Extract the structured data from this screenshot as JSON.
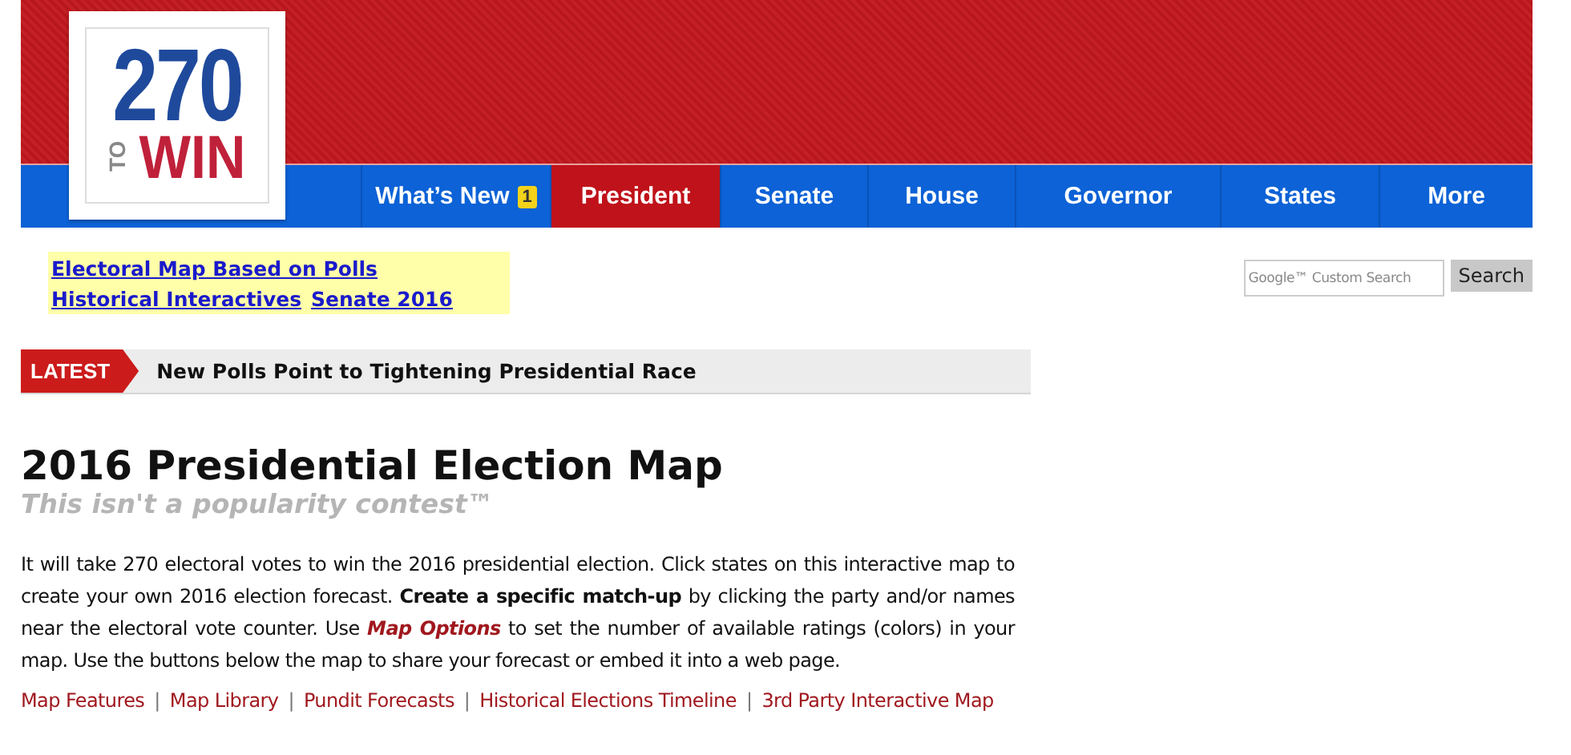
{
  "logo": {
    "number": "270",
    "small": "TO",
    "word": "WIN"
  },
  "nav": [
    {
      "label": "What’s New",
      "badge": "1",
      "selected": false
    },
    {
      "label": "President",
      "selected": true
    },
    {
      "label": "Senate",
      "selected": false
    },
    {
      "label": "House",
      "selected": false
    },
    {
      "label": "Governor",
      "selected": false
    },
    {
      "label": "States",
      "selected": false
    },
    {
      "label": "More",
      "selected": false
    }
  ],
  "quick_links": [
    [
      "Electoral Map Based on Polls"
    ],
    [
      "Historical Interactives",
      "Senate 2016"
    ]
  ],
  "search": {
    "placeholder": "Google™ Custom Search",
    "button": "Search"
  },
  "latest": {
    "label": "LATEST",
    "headline": "New Polls Point to Tightening Presidential Race"
  },
  "article": {
    "title": "2016 Presidential Election Map",
    "subtitle": "This isn't a popularity contest™",
    "paragraph": {
      "before": "It will take 270 electoral votes to win the 2016 presidential election. Click states on this interactive map to create your own 2016 election forecast. **Create a specific match-up** by clicking the party and/or names near the electoral vote counter. Use ",
      "link": "Map Options",
      "after": " to set the number of available ratings (colors) in your map. Use the buttons below the map to share your forecast or embed it into a web page."
    },
    "separator": "|",
    "links": [
      "Map Features",
      "Map Library",
      "Pundit Forecasts",
      "Historical Elections Timeline",
      "3rd Party Interactive Map"
    ]
  }
}
